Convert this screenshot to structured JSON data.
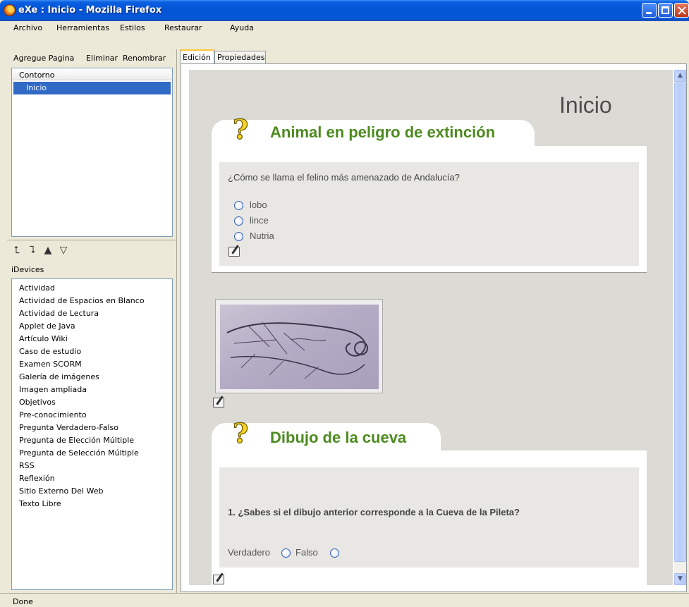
{
  "window": {
    "title": "eXe : Inicio - Mozilla Firefox"
  },
  "menu": [
    "Archivo",
    "Herramientas",
    "Estilos",
    "Restaurar",
    "Ayuda"
  ],
  "outline_toolbar": {
    "add": "Agregue Pagina",
    "delete": "Eliminar",
    "rename": "Renombrar"
  },
  "outline": {
    "header": "Contorno",
    "selected_node": "Inicio"
  },
  "idevices": {
    "label": "iDevices",
    "items": [
      "Actividad",
      "Actividad de Espacios en Blanco",
      "Actividad de Lectura",
      "Applet de Java",
      "Artículo Wiki",
      "Caso de estudio",
      "Examen SCORM",
      "Galería de imágenes",
      "Imagen ampliada",
      "Objetivos",
      "Pre-conocimiento",
      "Pregunta Verdadero-Falso",
      "Pregunta de Elección Múltiple",
      "Pregunta de Selección Múltiple",
      "RSS",
      "Reflexión",
      "Sitio Externo Del Web",
      "Texto Libre"
    ]
  },
  "tabs": {
    "edit": "Edición",
    "properties": "Propiedades"
  },
  "page": {
    "title": "Inicio",
    "idevice1": {
      "title": "Animal en peligro de extinción",
      "question": "¿Cómo se llama el felino más amenazado de Andalucía?",
      "options": [
        "lobo",
        "lince",
        "Nutria"
      ]
    },
    "idevice2": {
      "title": "Dibujo de la cueva",
      "question": "1. ¿Sabes si el dibujo anterior corresponde a la Cueva de la Pileta?",
      "true_label": "Verdadero",
      "false_label": "Falso"
    }
  },
  "status": "Done"
}
